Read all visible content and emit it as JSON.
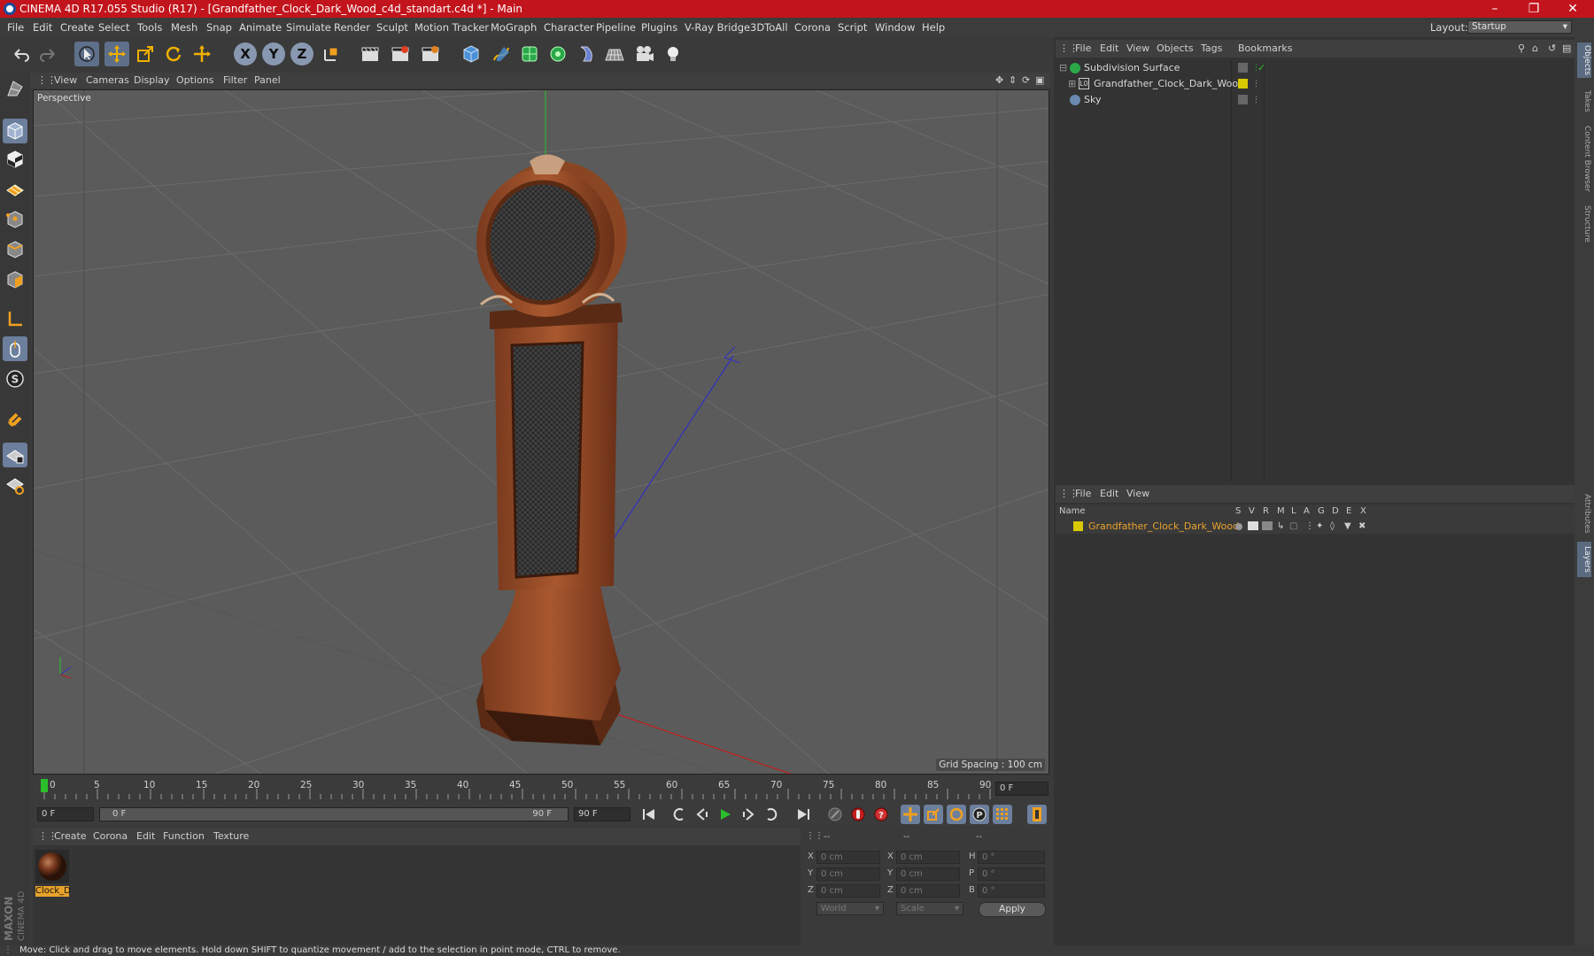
{
  "title": "CINEMA 4D R17.055 Studio (R17) - [Grandfather_Clock_Dark_Wood_c4d_standart.c4d *] - Main",
  "menu": [
    "File",
    "Edit",
    "Create",
    "Select",
    "Tools",
    "Mesh",
    "Snap",
    "Animate",
    "Simulate",
    "Render",
    "Sculpt",
    "Motion Tracker",
    "MoGraph",
    "Character",
    "Pipeline",
    "Plugins",
    "V-Ray Bridge",
    "3DToAll",
    "Corona",
    "Script",
    "Window",
    "Help"
  ],
  "layout": {
    "label": "Layout:",
    "value": "Startup"
  },
  "viewport": {
    "menu": [
      "View",
      "Cameras",
      "Display",
      "Options",
      "Filter",
      "Panel"
    ],
    "label": "Perspective",
    "grid_spacing": "Grid Spacing : 100 cm"
  },
  "timeline": {
    "ticks": [
      "0",
      "5",
      "10",
      "15",
      "20",
      "25",
      "30",
      "35",
      "40",
      "45",
      "50",
      "55",
      "60",
      "65",
      "70",
      "75",
      "80",
      "85",
      "90"
    ],
    "current_frame": "0 F",
    "start": "0 F",
    "range_start": "0 F",
    "range_end": "90 F",
    "end": "90 F"
  },
  "material_menu": [
    "Create",
    "Corona",
    "Edit",
    "Function",
    "Texture"
  ],
  "material": {
    "name": "Clock_D"
  },
  "coords": {
    "headers": [
      "--",
      "--",
      "--"
    ],
    "rows": [
      {
        "l1": "X",
        "v1": "0 cm",
        "l2": "X",
        "v2": "0 cm",
        "l3": "H",
        "v3": "0 °"
      },
      {
        "l1": "Y",
        "v1": "0 cm",
        "l2": "Y",
        "v2": "0 cm",
        "l3": "P",
        "v3": "0 °"
      },
      {
        "l1": "Z",
        "v1": "0 cm",
        "l2": "Z",
        "v2": "0 cm",
        "l3": "B",
        "v3": "0 °"
      }
    ],
    "world": "World",
    "scale": "Scale",
    "apply": "Apply"
  },
  "objects_menu": [
    "File",
    "Edit",
    "View",
    "Objects",
    "Tags",
    "Bookmarks"
  ],
  "objects": [
    {
      "name": "Subdivision Surface"
    },
    {
      "name": "Grandfather_Clock_Dark_Wood"
    },
    {
      "name": "Sky"
    }
  ],
  "layers_menu": [
    "File",
    "Edit",
    "View"
  ],
  "layers": {
    "header_name": "Name",
    "cols": [
      "S",
      "V",
      "R",
      "M",
      "L",
      "A",
      "G",
      "D",
      "E",
      "X"
    ],
    "rows": [
      {
        "name": "Grandfather_Clock_Dark_Wood"
      }
    ]
  },
  "side_tabs": [
    "Objects",
    "Takes",
    "Content Browser",
    "Structure",
    "Attributes",
    "Layers"
  ],
  "status": "Move: Click and drag to move elements. Hold down SHIFT to quantize movement / add to the selection in point mode, CTRL to remove.",
  "brand": "MAXON CINEMA 4D",
  "colors": {
    "title_bar": "#c2141c",
    "accent": "#6c7f9c",
    "layer_name": "#e8a22c",
    "layer_swatch": "#d8c800"
  }
}
